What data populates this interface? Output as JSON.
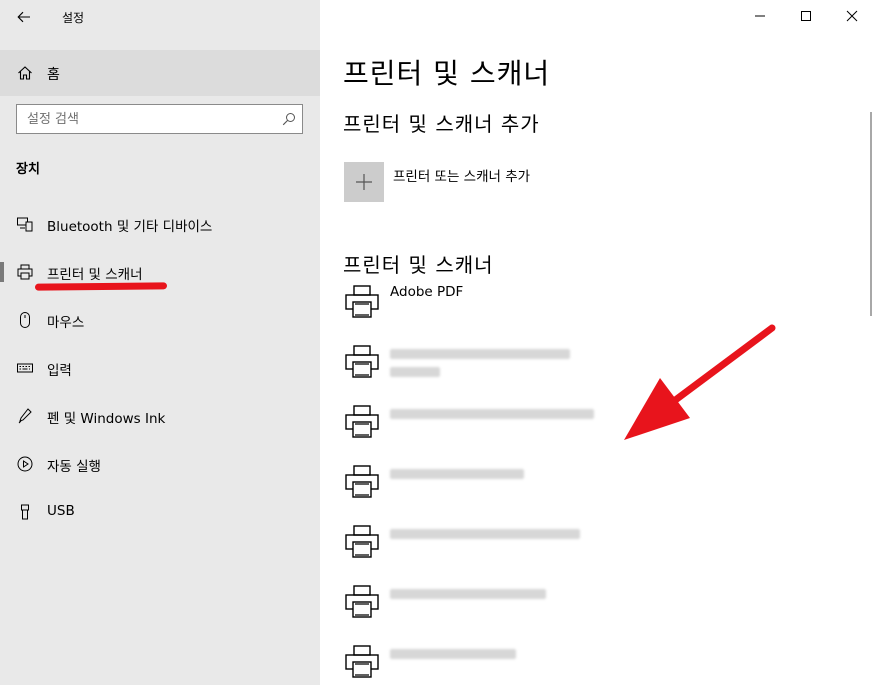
{
  "window": {
    "title": "설정",
    "controls": [
      "minimize",
      "maximize",
      "close"
    ]
  },
  "sidebar": {
    "back_icon": "back-arrow-icon",
    "home": {
      "label": "홈",
      "icon": "home-icon"
    },
    "search": {
      "placeholder": "설정 검색",
      "value": "",
      "icon": "search-icon"
    },
    "section_heading": "장치",
    "items": [
      {
        "label": "Bluetooth 및 기타 디바이스",
        "icon": "bluetooth-devices-icon",
        "selected": false
      },
      {
        "label": "프린터 및 스캐너",
        "icon": "printer-icon",
        "selected": true
      },
      {
        "label": "마우스",
        "icon": "mouse-icon",
        "selected": false
      },
      {
        "label": "입력",
        "icon": "keyboard-icon",
        "selected": false
      },
      {
        "label": "펜 및 Windows Ink",
        "icon": "pen-icon",
        "selected": false
      },
      {
        "label": "자동 실행",
        "icon": "autoplay-icon",
        "selected": false
      },
      {
        "label": "USB",
        "icon": "usb-icon",
        "selected": false
      }
    ]
  },
  "main": {
    "page_title": "프린터 및 스캐너",
    "add_section_title": "프린터 및 스캐너 추가",
    "add_button_label": "프린터 또는 스캐너 추가",
    "list_section_title": "프린터 및 스캐너",
    "printers": [
      {
        "name": "Adobe PDF",
        "blurred": false
      },
      {
        "name": "",
        "blurred": true
      },
      {
        "name": "",
        "blurred": true
      },
      {
        "name": "",
        "blurred": true
      },
      {
        "name": "",
        "blurred": true
      },
      {
        "name": "",
        "blurred": true
      },
      {
        "name": "",
        "blurred": true
      }
    ]
  },
  "annotations": {
    "underline_color": "#e8141c",
    "arrow_color": "#e8141c"
  }
}
